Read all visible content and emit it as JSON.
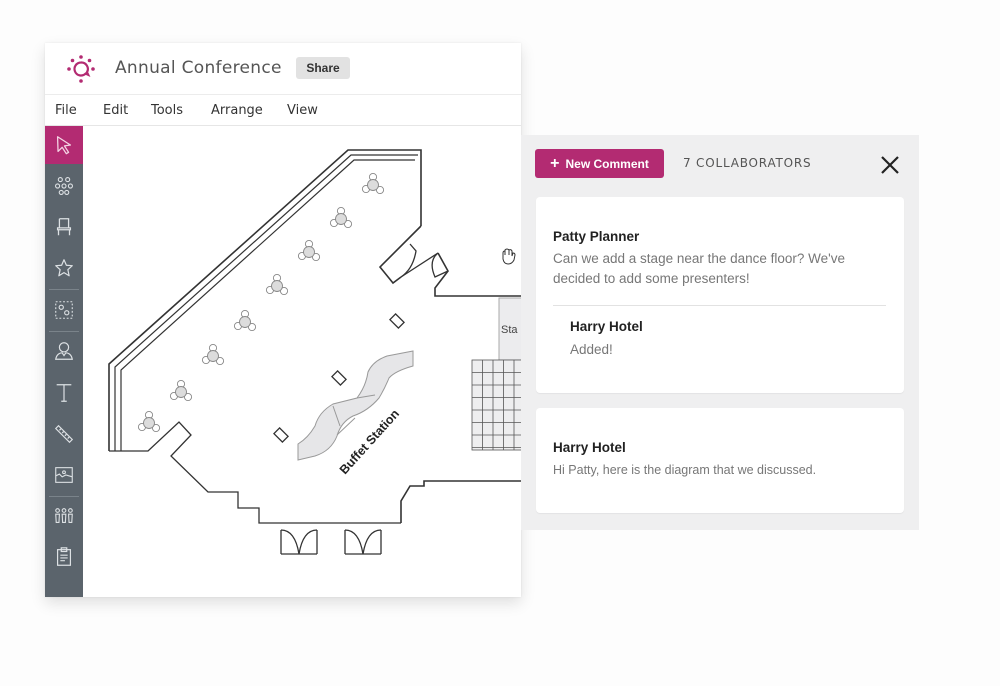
{
  "app": {
    "title": "Annual Conference",
    "share_label": "Share",
    "brand_color": "#b32b72",
    "logo_icon": "lightbulb-chat-icon"
  },
  "menu": [
    "File",
    "Edit",
    "Tools",
    "Arrange",
    "View"
  ],
  "toolbar": {
    "tools": [
      {
        "name": "select",
        "icon": "cursor-arrow-icon",
        "active": true
      },
      {
        "name": "tables",
        "icon": "round-tables-icon",
        "active": false
      },
      {
        "name": "chairs",
        "icon": "chair-icon",
        "active": false
      },
      {
        "name": "favorites",
        "icon": "star-icon",
        "active": false
      },
      {
        "name": "group",
        "icon": "group-selection-icon",
        "active": false
      },
      {
        "name": "attendees",
        "icon": "person-pin-icon",
        "active": false
      },
      {
        "name": "text",
        "icon": "text-icon",
        "active": false
      },
      {
        "name": "measure",
        "icon": "ruler-icon",
        "active": false
      },
      {
        "name": "background",
        "icon": "image-floorplan-icon",
        "active": false
      },
      {
        "name": "guests",
        "icon": "people-group-icon",
        "active": false
      },
      {
        "name": "notes",
        "icon": "clipboard-icon",
        "active": false
      }
    ]
  },
  "canvas": {
    "labels": {
      "buffet": "Buffet Station",
      "stage": "Sta"
    },
    "cursor_icon": "hand-grab-icon"
  },
  "comments": {
    "new_comment_label": "New Comment",
    "collaborators": "7 COLLABORATORS",
    "threads": [
      {
        "author": "Patty Planner",
        "text_line1": "Can we add a stage near the dance floor? We've",
        "text_line2": "decided to add some presenters!",
        "reply": {
          "author": "Harry Hotel",
          "text": "Added!"
        }
      },
      {
        "author": "Harry Hotel",
        "text": "Hi Patty, here is the diagram that we discussed."
      }
    ]
  }
}
